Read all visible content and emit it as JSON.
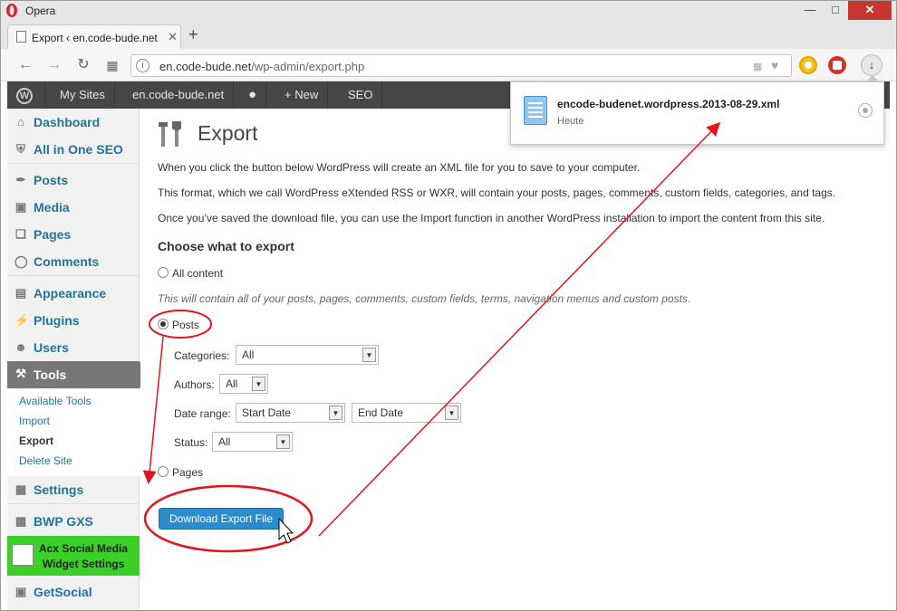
{
  "window": {
    "app_title": "Opera",
    "min_label": "—",
    "max_label": "□",
    "close_label": "✕"
  },
  "tab": {
    "label": "Export ‹ en.code-bude.net",
    "close_label": "✕",
    "new_tab_label": "+"
  },
  "toolbar": {
    "url_host": "en.code-bude.net",
    "url_path": "/wp-admin/export.php",
    "back_icon": "arrow-left-icon",
    "forward_icon": "arrow-right-icon",
    "reload_icon": "reload-icon"
  },
  "adminbar": {
    "logo": "W",
    "my_sites": "My Sites",
    "site": "en.code-bude.net",
    "comments_icon": "comment-bubble-icon",
    "new": "+ New",
    "seo": "SEO"
  },
  "sidebar": {
    "items": [
      {
        "label": "Dashboard",
        "icon": "house-icon"
      },
      {
        "label": "All in One SEO",
        "icon": "shield-icon"
      },
      {
        "label": "Posts",
        "icon": "pin-icon"
      },
      {
        "label": "Media",
        "icon": "camera-icon"
      },
      {
        "label": "Pages",
        "icon": "pages-icon"
      },
      {
        "label": "Comments",
        "icon": "comment-icon"
      },
      {
        "label": "Appearance",
        "icon": "appearance-icon"
      },
      {
        "label": "Plugins",
        "icon": "plug-icon"
      },
      {
        "label": "Users",
        "icon": "users-icon"
      },
      {
        "label": "Tools",
        "icon": "tools-icon"
      },
      {
        "label": "Settings",
        "icon": "settings-icon"
      },
      {
        "label": "BWP GXS",
        "icon": "sitemap-icon"
      },
      {
        "label": "GetSocial",
        "icon": "getsocial-icon"
      }
    ],
    "tools_submenu": [
      "Available Tools",
      "Import",
      "Export",
      "Delete Site"
    ],
    "acx_label_line1": "Acx Social Media",
    "acx_label_line2": "Widget Settings"
  },
  "main": {
    "title": "Export",
    "para1": "When you click the button below WordPress will create an XML file for you to save to your computer.",
    "para2": "This format, which we call WordPress eXtended RSS or WXR, will contain your posts, pages, comments, custom fields, categories, and tags.",
    "para3": "Once you’ve saved the download file, you can use the Import function in another WordPress installation to import the content from this site.",
    "choose_heading": "Choose what to export",
    "opt_all": "All content",
    "all_note": "This will contain all of your posts, pages, comments, custom fields, terms, navigation menus and custom posts.",
    "opt_posts": "Posts",
    "categories_label": "Categories:",
    "categories_value": "All",
    "authors_label": "Authors:",
    "authors_value": "All",
    "date_range_label": "Date range:",
    "start_date_value": "Start Date",
    "end_date_value": "End Date",
    "status_label": "Status:",
    "status_value": "All",
    "opt_pages": "Pages",
    "download_button": "Download Export File",
    "selected_option": "Posts"
  },
  "download_popup": {
    "file_name": "encode-budenet.wordpress.2013-08-29.xml",
    "date": "Heute"
  },
  "colors": {
    "wp_link": "#21759b",
    "admin_bar": "#464646",
    "primary_button": "#2a8ccc",
    "annotation_red": "#e3141c",
    "acx_green": "#3bd028"
  }
}
